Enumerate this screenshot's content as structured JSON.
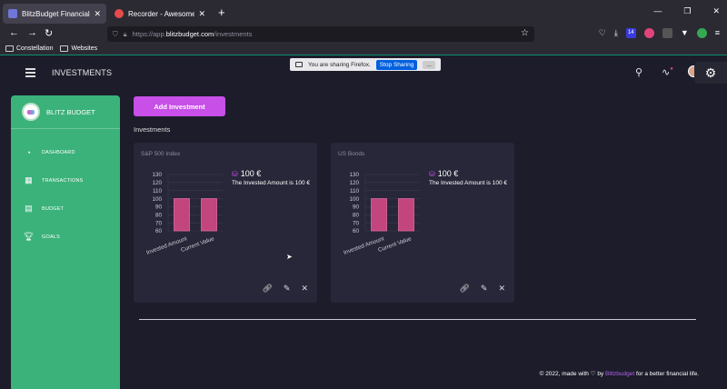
{
  "browser": {
    "tabs": [
      {
        "title": "BlitzBudget Financial Analyzer",
        "active": true,
        "favicon_color": "#6f76d8"
      },
      {
        "title": "Recorder - Awesome Screensho",
        "active": false,
        "favicon_color": "#e54b4b"
      }
    ],
    "url": {
      "prefix": "https://app.",
      "domain": "blitzbudget.com",
      "path": "/investments"
    },
    "bookmarks": [
      "Constellation",
      "Websites"
    ],
    "toolbar_badge": "14"
  },
  "app": {
    "page_title": "INVESTMENTS",
    "share_notice": {
      "text": "You are sharing Firefox.",
      "stop_label": "Stop Sharing",
      "more_label": "..."
    },
    "brand": "BLITZ BUDGET",
    "nav": [
      {
        "label": "DASHBOARD",
        "icon": "pie-chart-icon"
      },
      {
        "label": "TRANSACTIONS",
        "icon": "transactions-icon"
      },
      {
        "label": "BUDGET",
        "icon": "budget-icon"
      },
      {
        "label": "GOALS",
        "icon": "trophy-icon"
      }
    ],
    "add_button": "Add Investment",
    "section_title": "Investments",
    "footer": {
      "prefix": "© 2022, made with ♡ by ",
      "brand": "Blitzbudget",
      "suffix": " for a better financial life."
    }
  },
  "investments": [
    {
      "name": "S&P 500 Index",
      "amount": "100 €",
      "description": "The Invested Amount is 100 €",
      "actions": [
        "link-icon",
        "edit-icon",
        "close-icon"
      ]
    },
    {
      "name": "US Bonds",
      "amount": "100 €",
      "description": "The Invested Amount is 100 €",
      "actions": [
        "link-icon",
        "edit-icon",
        "close-icon"
      ]
    }
  ],
  "chart_data": [
    {
      "type": "bar",
      "categories": [
        "Invested Amount",
        "Current Value"
      ],
      "values": [
        100,
        100
      ],
      "yticks": [
        60,
        70,
        80,
        90,
        100,
        110,
        120,
        130
      ],
      "ylim": [
        60,
        130
      ],
      "bar_color": "#c2457e",
      "grid": true
    },
    {
      "type": "bar",
      "categories": [
        "Invested Amount",
        "Current Value"
      ],
      "values": [
        100,
        100
      ],
      "yticks": [
        60,
        70,
        80,
        90,
        100,
        110,
        120,
        130
      ],
      "ylim": [
        60,
        130
      ],
      "bar_color": "#c2457e",
      "grid": true
    }
  ]
}
